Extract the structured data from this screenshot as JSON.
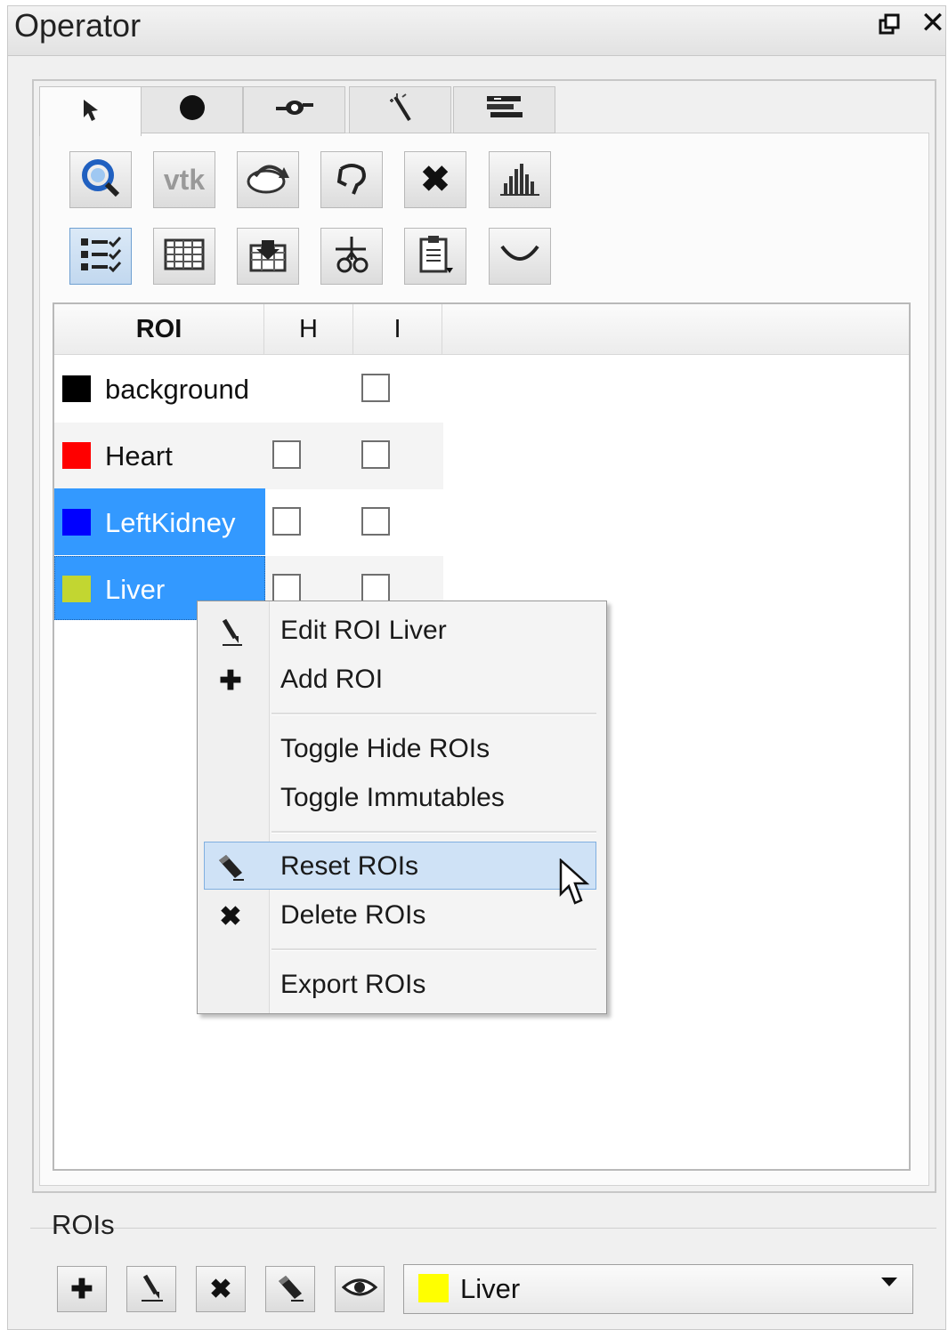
{
  "window": {
    "title": "Operator"
  },
  "tabs": [
    {
      "icon": "arrow-pointer-icon"
    },
    {
      "icon": "dot-icon"
    },
    {
      "icon": "brush-icon"
    },
    {
      "icon": "magic-wand-icon"
    },
    {
      "icon": "layers-icon"
    }
  ],
  "toolbar": {
    "row1": [
      {
        "icon": "zoom-search-icon"
      },
      {
        "label": "vtk"
      },
      {
        "icon": "rotate-3d-icon"
      },
      {
        "icon": "lasso-icon"
      },
      {
        "icon": "delete-icon"
      },
      {
        "icon": "histogram-icon"
      }
    ],
    "row2": [
      {
        "icon": "roi-list-icon"
      },
      {
        "icon": "table-icon"
      },
      {
        "icon": "import-icon"
      },
      {
        "icon": "scissors-icon"
      },
      {
        "icon": "clipboard-icon"
      },
      {
        "icon": "curve-icon"
      }
    ]
  },
  "table": {
    "headers": [
      "ROI",
      "H",
      "I"
    ],
    "rows": [
      {
        "name": "background",
        "color": "#000000",
        "hidden_checked": false,
        "immutable_checked": false,
        "has_hide": false
      },
      {
        "name": "Heart",
        "color": "#ff0000",
        "hidden_checked": false,
        "immutable_checked": false,
        "has_hide": true
      },
      {
        "name": "LeftKidney",
        "color": "#0000ff",
        "hidden_checked": false,
        "immutable_checked": false,
        "has_hide": true,
        "selected": true
      },
      {
        "name": "Liver",
        "color": "#c2d631",
        "hidden_checked": false,
        "immutable_checked": false,
        "has_hide": true,
        "selected": true
      }
    ],
    "selection_color": "#3399ff"
  },
  "context_menu": {
    "items": [
      {
        "label": "Edit ROI Liver",
        "icon": "pencil-icon"
      },
      {
        "label": "Add ROI",
        "icon": "plus-icon"
      },
      {
        "label": "Toggle Hide ROIs",
        "icon": ""
      },
      {
        "label": "Toggle Immutables",
        "icon": ""
      },
      {
        "label": "Reset ROIs",
        "icon": "eraser-icon",
        "highlighted": true
      },
      {
        "label": "Delete ROIs",
        "icon": "x-icon"
      },
      {
        "label": "Export ROIs",
        "icon": ""
      }
    ]
  },
  "rois_group": {
    "title": "ROIs",
    "buttons": [
      "plus-icon",
      "pencil-icon",
      "x-icon",
      "eraser-icon",
      "eye-icon"
    ],
    "selected_roi": {
      "label": "Liver",
      "color": "#ffff00"
    }
  }
}
